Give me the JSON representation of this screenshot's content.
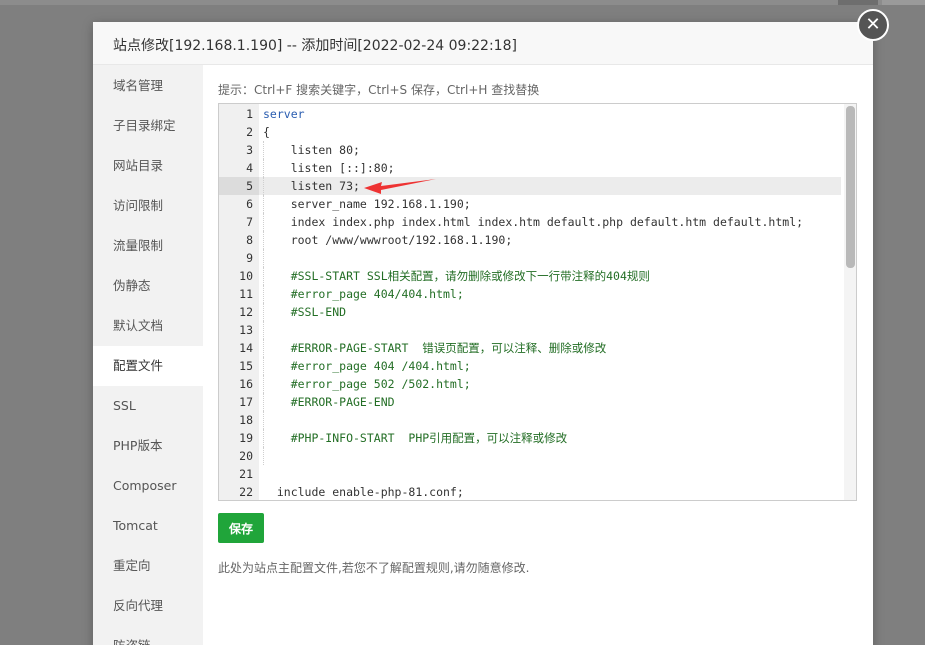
{
  "dialog": {
    "title": "站点修改[192.168.1.190] -- 添加时间[2022-02-24 09:22:18]",
    "close_glyph": "✕"
  },
  "sidebar": {
    "items": [
      {
        "label": "域名管理",
        "active": false
      },
      {
        "label": "子目录绑定",
        "active": false
      },
      {
        "label": "网站目录",
        "active": false
      },
      {
        "label": "访问限制",
        "active": false
      },
      {
        "label": "流量限制",
        "active": false
      },
      {
        "label": "伪静态",
        "active": false
      },
      {
        "label": "默认文档",
        "active": false
      },
      {
        "label": "配置文件",
        "active": true
      },
      {
        "label": "SSL",
        "active": false
      },
      {
        "label": "PHP版本",
        "active": false
      },
      {
        "label": "Composer",
        "active": false
      },
      {
        "label": "Tomcat",
        "active": false
      },
      {
        "label": "重定向",
        "active": false
      },
      {
        "label": "反向代理",
        "active": false
      },
      {
        "label": "防盗链",
        "active": false
      }
    ]
  },
  "editor": {
    "hint": "提示：Ctrl+F 搜索关键字，Ctrl+S 保存，Ctrl+H 查找替换",
    "current_line": 5,
    "lines": [
      {
        "n": "1",
        "text": "server",
        "type": "kw"
      },
      {
        "n": "2",
        "text": "{",
        "type": "plain"
      },
      {
        "n": "3",
        "text": "    listen 80;",
        "type": "plain"
      },
      {
        "n": "4",
        "text": "    listen [::]:80;",
        "type": "plain"
      },
      {
        "n": "5",
        "text": "    listen 73;",
        "type": "plain"
      },
      {
        "n": "6",
        "text": "    server_name 192.168.1.190;",
        "type": "plain"
      },
      {
        "n": "7",
        "text": "    index index.php index.html index.htm default.php default.htm default.html;",
        "type": "plain"
      },
      {
        "n": "8",
        "text": "    root /www/wwwroot/192.168.1.190;",
        "type": "plain"
      },
      {
        "n": "9",
        "text": "",
        "type": "plain"
      },
      {
        "n": "10",
        "text": "    #SSL-START SSL相关配置，请勿删除或修改下一行带注释的404规则",
        "type": "comment"
      },
      {
        "n": "11",
        "text": "    #error_page 404/404.html;",
        "type": "comment"
      },
      {
        "n": "12",
        "text": "    #SSL-END",
        "type": "comment"
      },
      {
        "n": "13",
        "text": "",
        "type": "plain"
      },
      {
        "n": "14",
        "text": "    #ERROR-PAGE-START  错误页配置，可以注释、删除或修改",
        "type": "comment"
      },
      {
        "n": "15",
        "text": "    #error_page 404 /404.html;",
        "type": "comment"
      },
      {
        "n": "16",
        "text": "    #error_page 502 /502.html;",
        "type": "comment"
      },
      {
        "n": "17",
        "text": "    #ERROR-PAGE-END",
        "type": "comment"
      },
      {
        "n": "18",
        "text": "",
        "type": "plain"
      },
      {
        "n": "19",
        "text": "    #PHP-INFO-START  PHP引用配置，可以注释或修改",
        "type": "comment"
      },
      {
        "n": "20",
        "text": "",
        "type": "plain"
      },
      {
        "n": "21",
        "text": "",
        "type": "plain"
      },
      {
        "n": "22",
        "text": "  include enable-php-81.conf;",
        "type": "plain"
      }
    ]
  },
  "save_button": {
    "label": "保存"
  },
  "footer_note": "此处为站点主配置文件,若您不了解配置规则,请勿随意修改.",
  "colors": {
    "accent_green": "#20a53a",
    "comment_green": "#236e25",
    "keyword_blue": "#2a5db0",
    "annotation_red": "#ee3333"
  }
}
